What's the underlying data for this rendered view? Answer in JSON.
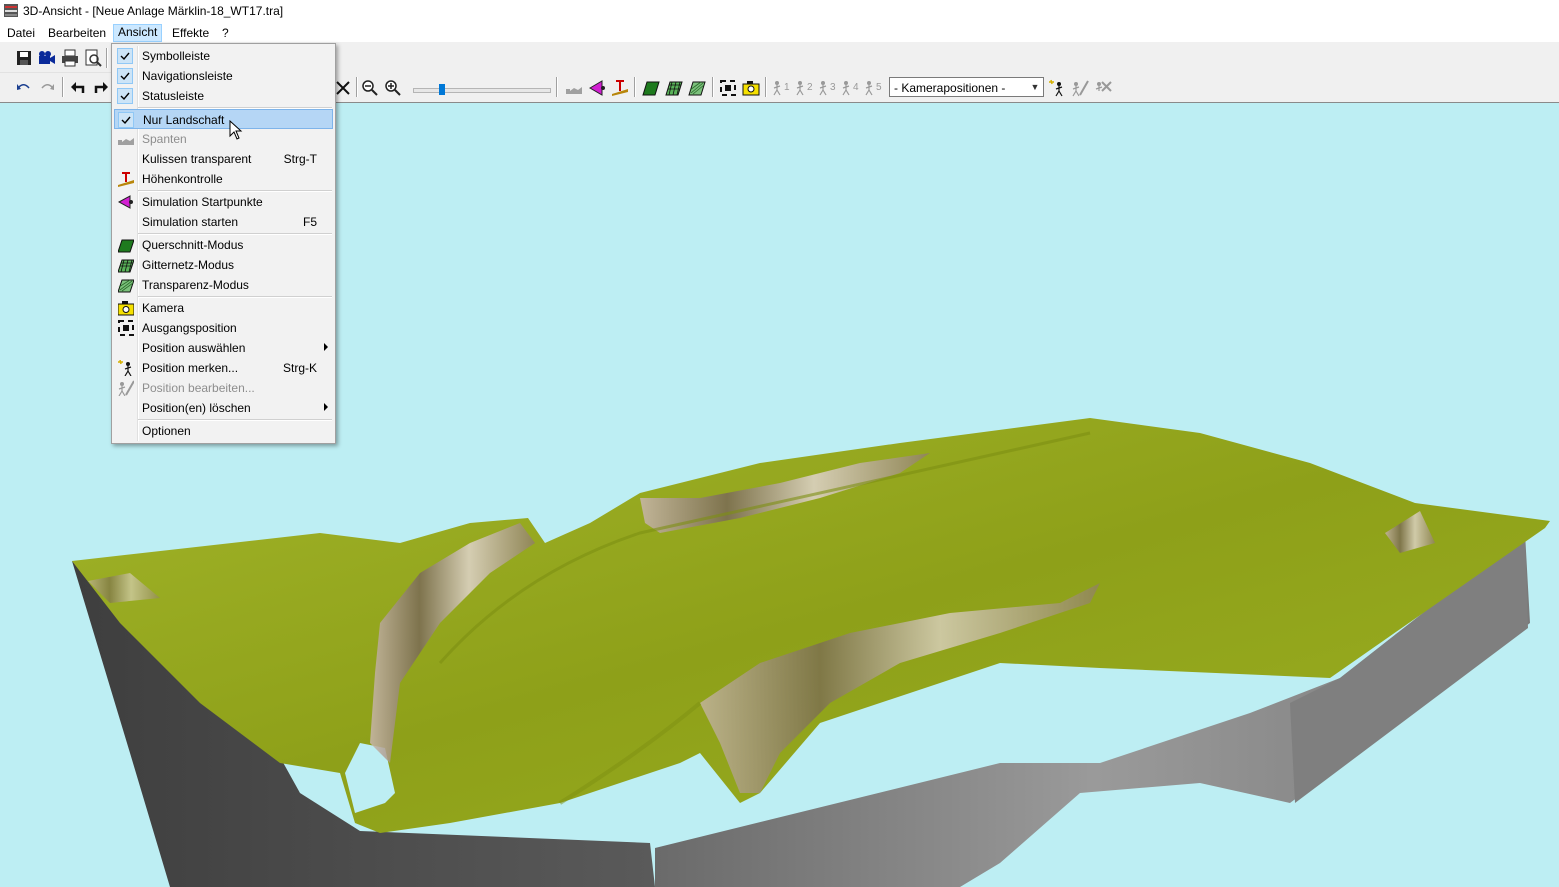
{
  "window": {
    "title": "3D-Ansicht - [Neue Anlage Märklin-18_WT17.tra]"
  },
  "menubar": [
    {
      "id": "datei",
      "label": "Datei"
    },
    {
      "id": "bearbeiten",
      "label": "Bearbeiten"
    },
    {
      "id": "ansicht",
      "label": "Ansicht"
    },
    {
      "id": "effekte",
      "label": "Effekte"
    },
    {
      "id": "help",
      "label": "?"
    }
  ],
  "toolbar": {
    "camera_combo": "- Kamerapositionen -",
    "camera_slots": [
      "1",
      "2",
      "3",
      "4",
      "5"
    ],
    "zoom_slider_fraction": 0.2
  },
  "ansicht_menu": {
    "items": [
      {
        "label": "Symbolleiste",
        "checked": true
      },
      {
        "label": "Navigationsleiste",
        "checked": true
      },
      {
        "label": "Statusleiste",
        "checked": true
      },
      {
        "label": "Nur Landschaft",
        "checked": true,
        "selected": true
      },
      {
        "label": "Spanten",
        "disabled": true,
        "icon": "spanten-icon"
      },
      {
        "label": "Kulissen transparent",
        "shortcut": "Strg-T"
      },
      {
        "label": "Höhenkontrolle",
        "icon": "height-check-icon"
      },
      {
        "label": "Simulation Startpunkte",
        "icon": "simulation-start-icon"
      },
      {
        "label": "Simulation starten",
        "shortcut": "F5"
      },
      {
        "label": "Querschnitt-Modus",
        "icon": "cross-section-icon"
      },
      {
        "label": "Gitternetz-Modus",
        "icon": "grid-mode-icon"
      },
      {
        "label": "Transparenz-Modus",
        "icon": "transparency-mode-icon"
      },
      {
        "label": "Kamera",
        "icon": "camera-icon"
      },
      {
        "label": "Ausgangsposition",
        "icon": "home-position-icon"
      },
      {
        "label": "Position auswählen",
        "submenu": true
      },
      {
        "label": "Position merken...",
        "shortcut": "Strg-K",
        "icon": "save-position-icon"
      },
      {
        "label": "Position bearbeiten...",
        "disabled": true,
        "icon": "edit-position-icon"
      },
      {
        "label": "Position(en) löschen",
        "submenu": true
      },
      {
        "label": "Optionen"
      }
    ]
  },
  "colors": {
    "sky": "#bdeef3",
    "terrain": "#95a61c",
    "base_dark": "#4d4d4d",
    "base_light": "#8c8c8c",
    "selection": "#b5d6f5",
    "accent": "#0078d7"
  }
}
